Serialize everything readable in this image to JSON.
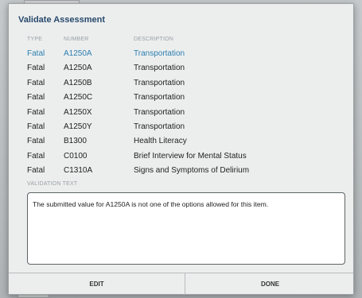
{
  "dialog": {
    "title": "Validate Assessment",
    "columns": {
      "type": "TYPE",
      "number": "NUMBER",
      "description": "DESCRIPTION"
    },
    "rows": [
      {
        "type": "Fatal",
        "number": "A1250A",
        "description": "Transportation",
        "selected": true
      },
      {
        "type": "Fatal",
        "number": "A1250A",
        "description": "Transportation"
      },
      {
        "type": "Fatal",
        "number": "A1250B",
        "description": "Transportation"
      },
      {
        "type": "Fatal",
        "number": "A1250C",
        "description": "Transportation"
      },
      {
        "type": "Fatal",
        "number": "A1250X",
        "description": "Transportation"
      },
      {
        "type": "Fatal",
        "number": "A1250Y",
        "description": "Transportation"
      },
      {
        "type": "Fatal",
        "number": "B1300",
        "description": "Health Literacy"
      },
      {
        "type": "Fatal",
        "number": "C0100",
        "description": "Brief Interview for Mental Status"
      },
      {
        "type": "Fatal",
        "number": "C1310A",
        "description": "Signs and Symptoms of Delirium"
      }
    ],
    "validation_label": "VALIDATION TEXT",
    "validation_text": "The submitted value for A1250A is not one of the options allowed for this item.",
    "buttons": {
      "edit": "EDIT",
      "done": "DONE"
    },
    "colors": {
      "title": "#27496b",
      "selected_row": "#2d7fb0"
    }
  }
}
